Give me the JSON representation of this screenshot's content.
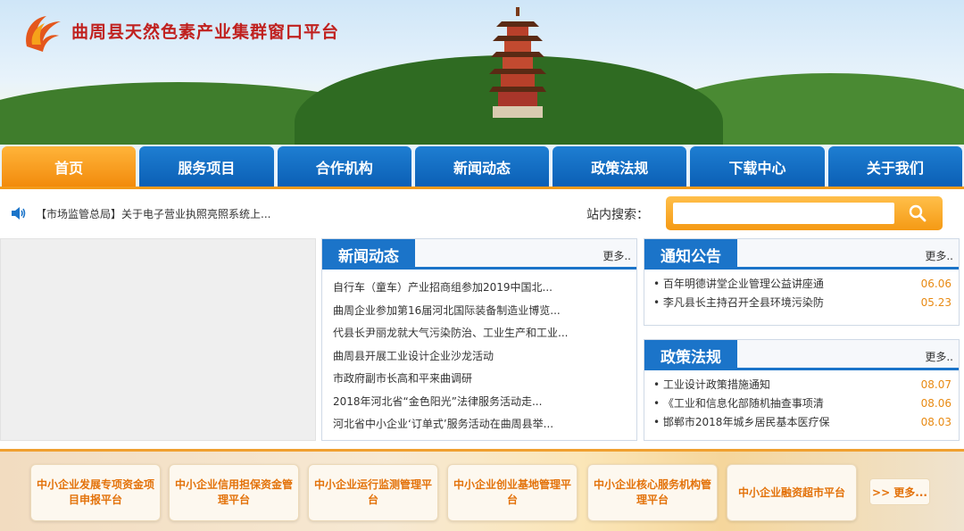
{
  "header": {
    "site_title": "曲周县天然色素产业集群窗口平台"
  },
  "nav": {
    "items": [
      {
        "label": "首页"
      },
      {
        "label": "服务项目"
      },
      {
        "label": "合作机构"
      },
      {
        "label": "新闻动态"
      },
      {
        "label": "政策法规"
      },
      {
        "label": "下载中心"
      },
      {
        "label": "关于我们"
      }
    ],
    "active": "首页"
  },
  "notice": {
    "text": "【市场监管总局】关于电子营业执照亮照系统上..."
  },
  "search": {
    "label": "站内搜索：",
    "placeholder": ""
  },
  "news": {
    "title": "新闻动态",
    "more": "更多..",
    "items": [
      "自行车（童车）产业招商组参加2019中国北...",
      "曲周企业参加第16届河北国际装备制造业博览...",
      "代县长尹丽龙就大气污染防治、工业生产和工业...",
      "曲周县开展工业设计企业沙龙活动",
      "市政府副市长高和平来曲调研",
      "2018年河北省“金色阳光”法律服务活动走...",
      "河北省中小企业‘订单式’服务活动在曲周县举..."
    ]
  },
  "notices": {
    "title": "通知公告",
    "more": "更多..",
    "items": [
      {
        "text": "百年明德讲堂企业管理公益讲座通",
        "date": "06.06"
      },
      {
        "text": "李凡县长主持召开全县环境污染防",
        "date": "05.23"
      }
    ]
  },
  "policy": {
    "title": "政策法规",
    "more": "更多..",
    "items": [
      {
        "text": "工业设计政策措施通知",
        "date": "08.07"
      },
      {
        "text": "《工业和信息化部随机抽查事项清",
        "date": "08.06"
      },
      {
        "text": "邯郸市2018年城乡居民基本医疗保",
        "date": "08.03"
      }
    ]
  },
  "platforms": {
    "items": [
      "中小企业发展专项资金项目申报平台",
      "中小企业信用担保资金管理平台",
      "中小企业运行监测管理平台",
      "中小企业创业基地管理平台",
      "中小企业核心服务机构管理平台",
      "中小企业融资超市平台"
    ],
    "more": ">> 更多..."
  },
  "colors": {
    "nav_blue": "#0b5fb5",
    "nav_active": "#f28b0c",
    "title_red": "#c0211f",
    "accent_orange": "#e88a13"
  },
  "icons": [
    "phoenix-logo-icon",
    "speaker-icon",
    "search-icon",
    "pagoda-illustration"
  ]
}
